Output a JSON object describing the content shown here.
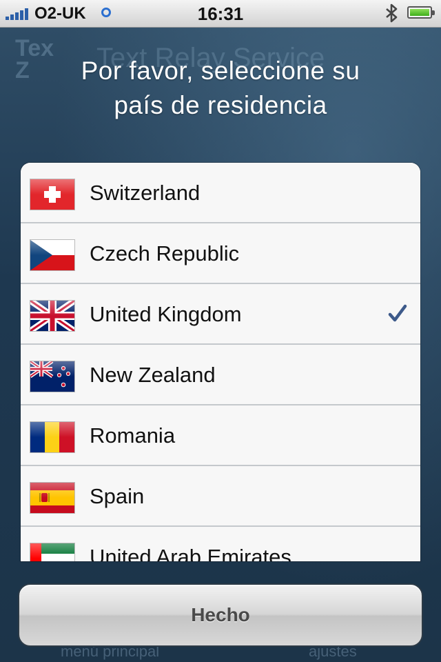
{
  "status_bar": {
    "carrier": "O2-UK",
    "time": "16:31",
    "signal_icon": "signal-bars-icon",
    "wifi_icon": "wifi-icon",
    "bluetooth_icon": "bluetooth-icon",
    "battery_icon": "battery-icon",
    "battery_color": "#3eae1a"
  },
  "background_app": {
    "logo": "Tex\nZ",
    "title": "Text Relay Service",
    "footer_left": "menú principal",
    "footer_right": "ajustes"
  },
  "prompt": {
    "line1": "Por favor, seleccione su",
    "line2": "país de residencia"
  },
  "countries": [
    {
      "name": "Switzerland",
      "flag": "swiss-flag-icon",
      "selected": false
    },
    {
      "name": "Czech Republic",
      "flag": "czech-flag-icon",
      "selected": false
    },
    {
      "name": "United Kingdom",
      "flag": "uk-flag-icon",
      "selected": true
    },
    {
      "name": "New Zealand",
      "flag": "nz-flag-icon",
      "selected": false
    },
    {
      "name": "Romania",
      "flag": "romania-flag-icon",
      "selected": false
    },
    {
      "name": "Spain",
      "flag": "spain-flag-icon",
      "selected": false
    },
    {
      "name": "United Arab Emirates",
      "flag": "uae-flag-icon",
      "selected": false
    }
  ],
  "done_button": {
    "label": "Hecho"
  },
  "colors": {
    "checkmark": "#3d5a8a",
    "background": "#223f57"
  }
}
